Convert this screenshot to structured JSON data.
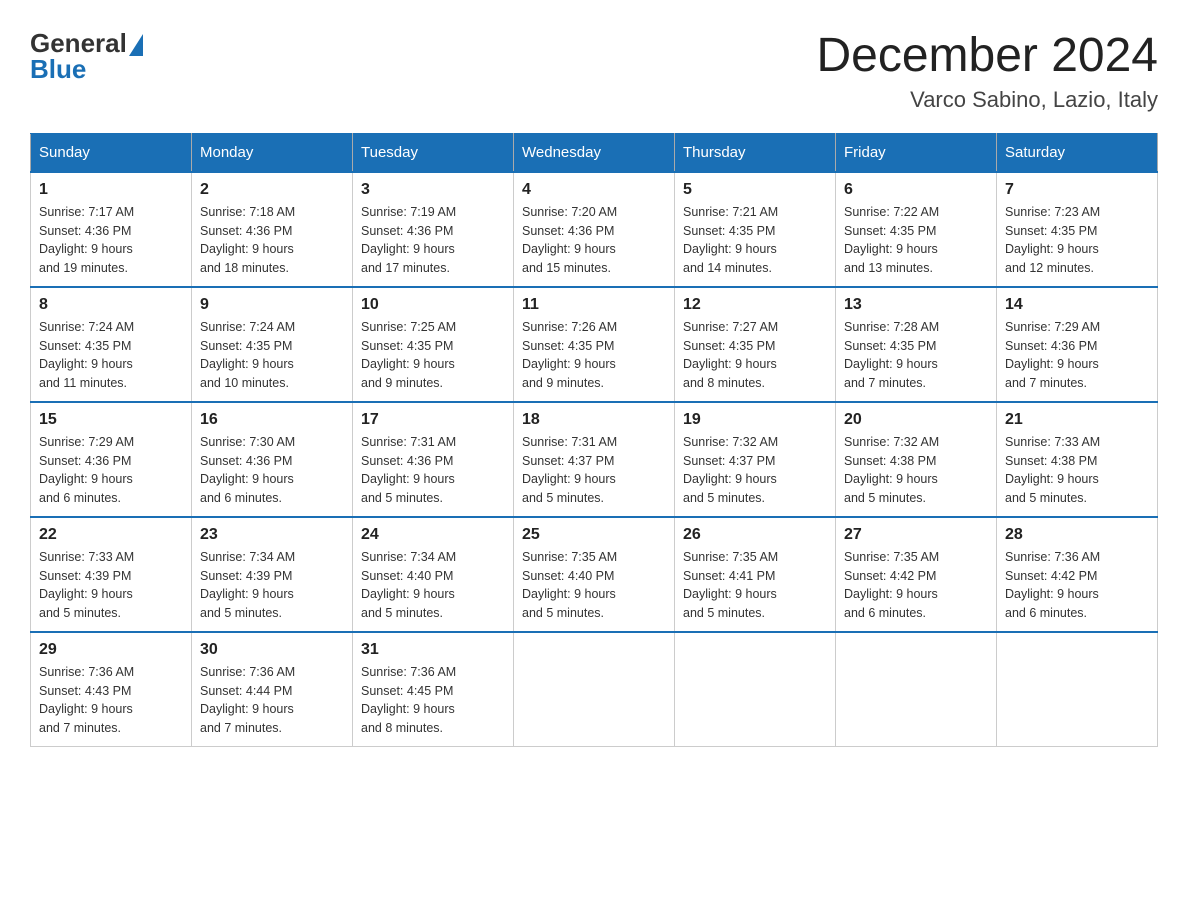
{
  "header": {
    "logo_general": "General",
    "logo_blue": "Blue",
    "month_year": "December 2024",
    "location": "Varco Sabino, Lazio, Italy"
  },
  "days_of_week": [
    "Sunday",
    "Monday",
    "Tuesday",
    "Wednesday",
    "Thursday",
    "Friday",
    "Saturday"
  ],
  "weeks": [
    [
      {
        "day": "1",
        "sunrise": "7:17 AM",
        "sunset": "4:36 PM",
        "daylight": "9 hours and 19 minutes."
      },
      {
        "day": "2",
        "sunrise": "7:18 AM",
        "sunset": "4:36 PM",
        "daylight": "9 hours and 18 minutes."
      },
      {
        "day": "3",
        "sunrise": "7:19 AM",
        "sunset": "4:36 PM",
        "daylight": "9 hours and 17 minutes."
      },
      {
        "day": "4",
        "sunrise": "7:20 AM",
        "sunset": "4:36 PM",
        "daylight": "9 hours and 15 minutes."
      },
      {
        "day": "5",
        "sunrise": "7:21 AM",
        "sunset": "4:35 PM",
        "daylight": "9 hours and 14 minutes."
      },
      {
        "day": "6",
        "sunrise": "7:22 AM",
        "sunset": "4:35 PM",
        "daylight": "9 hours and 13 minutes."
      },
      {
        "day": "7",
        "sunrise": "7:23 AM",
        "sunset": "4:35 PM",
        "daylight": "9 hours and 12 minutes."
      }
    ],
    [
      {
        "day": "8",
        "sunrise": "7:24 AM",
        "sunset": "4:35 PM",
        "daylight": "9 hours and 11 minutes."
      },
      {
        "day": "9",
        "sunrise": "7:24 AM",
        "sunset": "4:35 PM",
        "daylight": "9 hours and 10 minutes."
      },
      {
        "day": "10",
        "sunrise": "7:25 AM",
        "sunset": "4:35 PM",
        "daylight": "9 hours and 9 minutes."
      },
      {
        "day": "11",
        "sunrise": "7:26 AM",
        "sunset": "4:35 PM",
        "daylight": "9 hours and 9 minutes."
      },
      {
        "day": "12",
        "sunrise": "7:27 AM",
        "sunset": "4:35 PM",
        "daylight": "9 hours and 8 minutes."
      },
      {
        "day": "13",
        "sunrise": "7:28 AM",
        "sunset": "4:35 PM",
        "daylight": "9 hours and 7 minutes."
      },
      {
        "day": "14",
        "sunrise": "7:29 AM",
        "sunset": "4:36 PM",
        "daylight": "9 hours and 7 minutes."
      }
    ],
    [
      {
        "day": "15",
        "sunrise": "7:29 AM",
        "sunset": "4:36 PM",
        "daylight": "9 hours and 6 minutes."
      },
      {
        "day": "16",
        "sunrise": "7:30 AM",
        "sunset": "4:36 PM",
        "daylight": "9 hours and 6 minutes."
      },
      {
        "day": "17",
        "sunrise": "7:31 AM",
        "sunset": "4:36 PM",
        "daylight": "9 hours and 5 minutes."
      },
      {
        "day": "18",
        "sunrise": "7:31 AM",
        "sunset": "4:37 PM",
        "daylight": "9 hours and 5 minutes."
      },
      {
        "day": "19",
        "sunrise": "7:32 AM",
        "sunset": "4:37 PM",
        "daylight": "9 hours and 5 minutes."
      },
      {
        "day": "20",
        "sunrise": "7:32 AM",
        "sunset": "4:38 PM",
        "daylight": "9 hours and 5 minutes."
      },
      {
        "day": "21",
        "sunrise": "7:33 AM",
        "sunset": "4:38 PM",
        "daylight": "9 hours and 5 minutes."
      }
    ],
    [
      {
        "day": "22",
        "sunrise": "7:33 AM",
        "sunset": "4:39 PM",
        "daylight": "9 hours and 5 minutes."
      },
      {
        "day": "23",
        "sunrise": "7:34 AM",
        "sunset": "4:39 PM",
        "daylight": "9 hours and 5 minutes."
      },
      {
        "day": "24",
        "sunrise": "7:34 AM",
        "sunset": "4:40 PM",
        "daylight": "9 hours and 5 minutes."
      },
      {
        "day": "25",
        "sunrise": "7:35 AM",
        "sunset": "4:40 PM",
        "daylight": "9 hours and 5 minutes."
      },
      {
        "day": "26",
        "sunrise": "7:35 AM",
        "sunset": "4:41 PM",
        "daylight": "9 hours and 5 minutes."
      },
      {
        "day": "27",
        "sunrise": "7:35 AM",
        "sunset": "4:42 PM",
        "daylight": "9 hours and 6 minutes."
      },
      {
        "day": "28",
        "sunrise": "7:36 AM",
        "sunset": "4:42 PM",
        "daylight": "9 hours and 6 minutes."
      }
    ],
    [
      {
        "day": "29",
        "sunrise": "7:36 AM",
        "sunset": "4:43 PM",
        "daylight": "9 hours and 7 minutes."
      },
      {
        "day": "30",
        "sunrise": "7:36 AM",
        "sunset": "4:44 PM",
        "daylight": "9 hours and 7 minutes."
      },
      {
        "day": "31",
        "sunrise": "7:36 AM",
        "sunset": "4:45 PM",
        "daylight": "9 hours and 8 minutes."
      },
      null,
      null,
      null,
      null
    ]
  ],
  "labels": {
    "sunrise": "Sunrise:",
    "sunset": "Sunset:",
    "daylight": "Daylight:"
  }
}
